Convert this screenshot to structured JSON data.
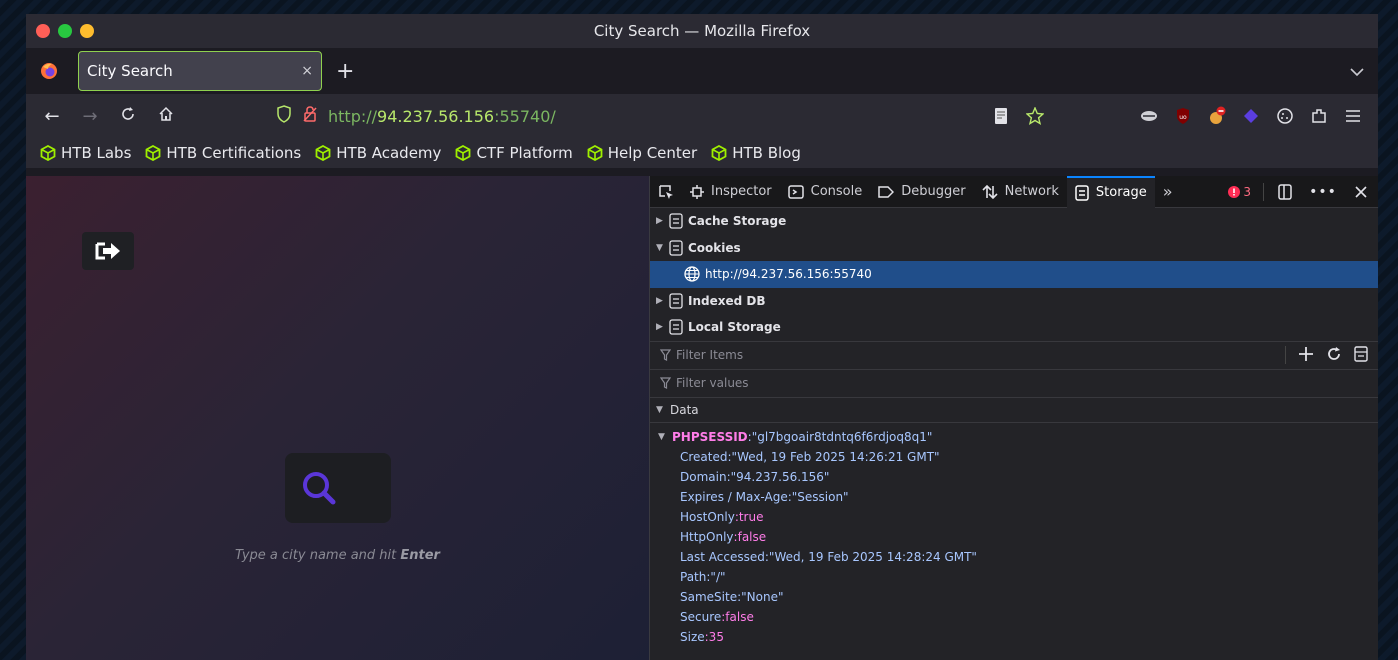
{
  "window": {
    "title": "City Search — Mozilla Firefox"
  },
  "tab": {
    "title": "City Search",
    "close": "×",
    "new": "+"
  },
  "url": {
    "scheme": "http://",
    "host": "94.237.56.156",
    "port": ":55740/"
  },
  "bookmarks": [
    "HTB Labs",
    "HTB Certifications",
    "HTB Academy",
    "CTF Platform",
    "Help Center",
    "HTB Blog"
  ],
  "page": {
    "hint_prefix": "Type a city name and hit ",
    "hint_key": "Enter"
  },
  "devtools": {
    "tabs": [
      "Inspector",
      "Console",
      "Debugger",
      "Network",
      "Storage"
    ],
    "error_count": "3",
    "tree": {
      "cache": "Cache Storage",
      "cookies": "Cookies",
      "cookie_host": "http://94.237.56.156:55740",
      "indexed": "Indexed DB",
      "local": "Local Storage"
    },
    "filter_items": "Filter Items",
    "filter_values": "Filter values",
    "data_label": "Data",
    "cookie": {
      "name": "PHPSESSID",
      "value": ":\"gl7bgoair8tdntq6f6rdjoq8q1\"",
      "props": [
        {
          "k": "Created",
          "v": ":\"Wed, 19 Feb 2025 14:26:21 GMT\"",
          "b": false
        },
        {
          "k": "Domain",
          "v": ":\"94.237.56.156\"",
          "b": false
        },
        {
          "k": "Expires / Max-Age",
          "v": ":\"Session\"",
          "b": false
        },
        {
          "k": "HostOnly",
          "v": ":true",
          "b": true
        },
        {
          "k": "HttpOnly",
          "v": ":false",
          "b": true
        },
        {
          "k": "Last Accessed",
          "v": ":\"Wed, 19 Feb 2025 14:28:24 GMT\"",
          "b": false
        },
        {
          "k": "Path",
          "v": ":\"/\"",
          "b": false
        },
        {
          "k": "SameSite",
          "v": ":\"None\"",
          "b": false
        },
        {
          "k": "Secure",
          "v": ":false",
          "b": true
        },
        {
          "k": "Size",
          "v": ":35",
          "b": true
        }
      ]
    }
  },
  "colors": {
    "accent": "#0a84ff",
    "bookmark_icon": "#9fef00",
    "tab_border": "#8fd14f"
  }
}
